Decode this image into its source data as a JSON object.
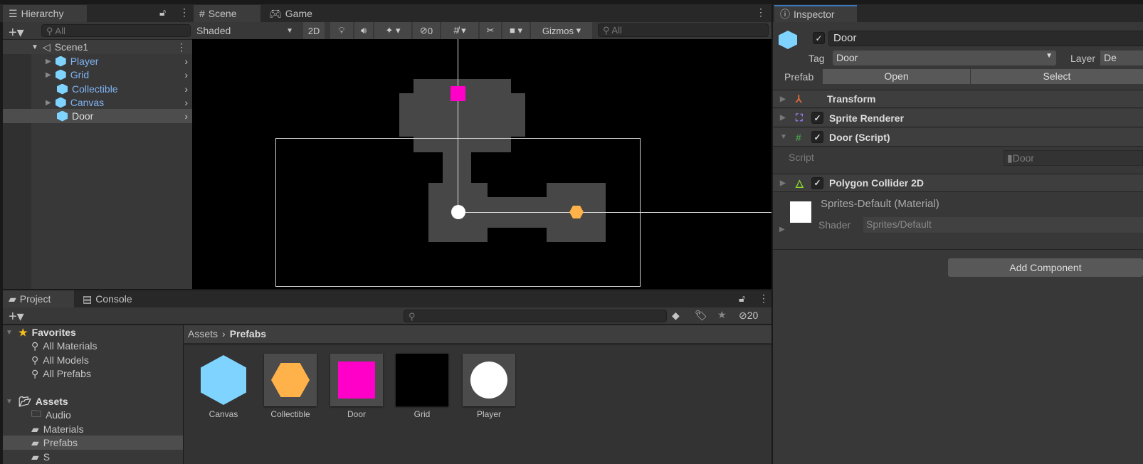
{
  "hierarchy": {
    "tab": "Hierarchy",
    "search_placeholder": "All",
    "scene": "Scene1",
    "items": [
      {
        "label": "Player",
        "expandable": true
      },
      {
        "label": "Grid",
        "expandable": true
      },
      {
        "label": "Collectible",
        "expandable": false
      },
      {
        "label": "Canvas",
        "expandable": true
      },
      {
        "label": "Door",
        "expandable": false,
        "selected": true
      }
    ]
  },
  "scene": {
    "tabs": [
      "Scene",
      "Game"
    ],
    "shading": "Shaded",
    "mode_2d": "2D",
    "hidden_count": "0",
    "gizmos": "Gizmos",
    "search_placeholder": "All",
    "colors": {
      "door": "#ff00c8",
      "collectible": "#ffb14a",
      "player": "#ffffff",
      "room": "#474747"
    }
  },
  "inspector": {
    "tab": "Inspector",
    "object_name": "Door",
    "tag_label": "Tag",
    "tag_value": "Door",
    "layer_label": "Layer",
    "layer_value": "De",
    "prefab_label": "Prefab",
    "open": "Open",
    "select": "Select",
    "components": [
      "Transform",
      "Sprite Renderer",
      "Door (Script)",
      "Polygon Collider 2D"
    ],
    "script_label": "Script",
    "script_value": "Door",
    "material": "Sprites-Default (Material)",
    "shader_label": "Shader",
    "shader_value": "Sprites/Default",
    "add_component": "Add Component"
  },
  "project": {
    "tabs": [
      "Project",
      "Console"
    ],
    "hidden_count": "20",
    "favorites": "Favorites",
    "fav_items": [
      "All Materials",
      "All Models",
      "All Prefabs"
    ],
    "assets": "Assets",
    "folders": [
      "Audio",
      "Materials",
      "Prefabs",
      "S"
    ],
    "breadcrumb": [
      "Assets",
      "Prefabs"
    ],
    "files": [
      "Canvas",
      "Collectible",
      "Door",
      "Grid",
      "Player"
    ]
  }
}
